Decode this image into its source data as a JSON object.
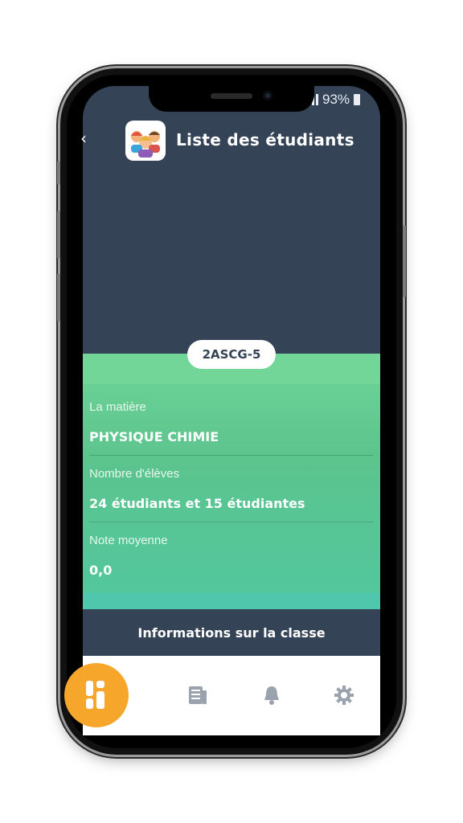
{
  "status_bar": {
    "battery": "93%"
  },
  "header": {
    "title": "Liste des étudiants"
  },
  "class_badge": "2ASCG-5",
  "fields": [
    {
      "label": "La matière",
      "value": "PHYSIQUE CHIMIE"
    },
    {
      "label": "Nombre d'élèves",
      "value": "24 étudiants et 15 étudiantes"
    },
    {
      "label": "Note moyenne",
      "value": "0,0"
    }
  ],
  "info_bar": "Informations sur la classe",
  "bottom_nav": {
    "items": [
      "classes-icon",
      "document-icon",
      "bell-icon",
      "gear-icon"
    ]
  },
  "colors": {
    "header_bg": "#344356",
    "panel_green": "#5cc48d",
    "fab_orange": "#f6a62a",
    "nav_icon": "#9aa3ad"
  }
}
